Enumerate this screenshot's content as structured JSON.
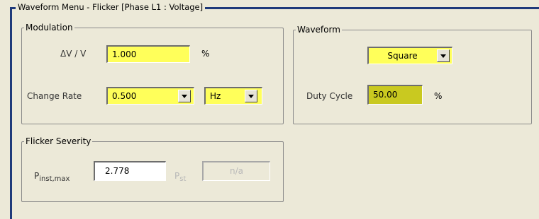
{
  "window": {
    "title": "Waveform Menu - Flicker [Phase L1 : Voltage]"
  },
  "modulation": {
    "legend": "Modulation",
    "dv_label": "ΔV / V",
    "dv_value": "1.000",
    "dv_unit": "%",
    "change_rate_label": "Change Rate",
    "change_rate_value": "0.500",
    "change_rate_unit": "Hz"
  },
  "waveform": {
    "legend": "Waveform",
    "shape_value": "Square",
    "duty_label": "Duty Cycle",
    "duty_value": "50.00",
    "duty_unit": "%"
  },
  "flicker": {
    "legend": "Flicker Severity",
    "pinst_label_main": "P",
    "pinst_label_sub": "inst,max",
    "pinst_value": "2.778",
    "pst_label_main": "P",
    "pst_label_sub": "st",
    "pst_value": "n/a"
  },
  "colors": {
    "field_active": "#ffff5a",
    "field_dark": "#c9c920",
    "frame": "#1f3a7a",
    "background": "#ece9d8"
  }
}
